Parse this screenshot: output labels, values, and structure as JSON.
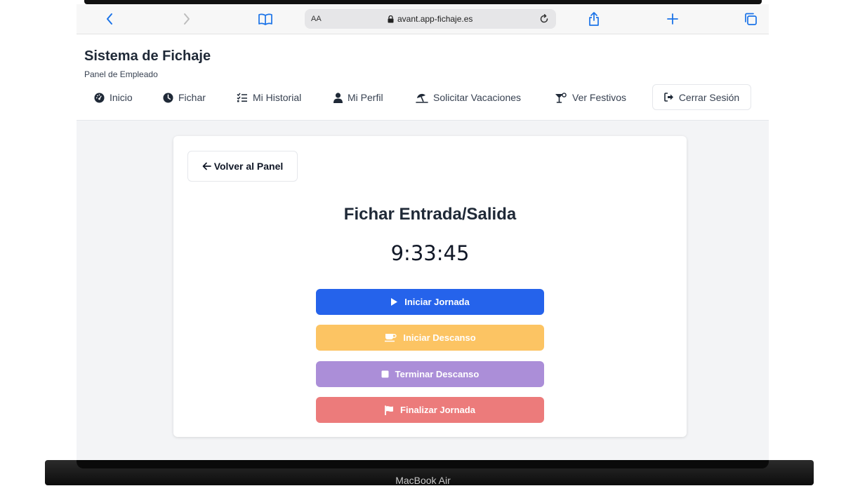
{
  "browser": {
    "address_aa": "AA",
    "url": "avant.app-fichaje.es",
    "icons": [
      "chevron-left-icon",
      "chevron-right-icon",
      "book-icon",
      "lock-icon",
      "reload-icon",
      "share-icon",
      "plus-icon",
      "tabs-icon"
    ]
  },
  "app": {
    "title": "Sistema de Fichaje",
    "subtitle": "Panel de Empleado"
  },
  "nav": {
    "inicio": "Inicio",
    "fichar": "Fichar",
    "historial": "Mi Historial",
    "perfil": "Mi Perfil",
    "vacaciones": "Solicitar Vacaciones",
    "festivos": "Ver Festivos",
    "logout": "Cerrar Sesión"
  },
  "card": {
    "back_label": "Volver al Panel",
    "title": "Fichar Entrada/Salida",
    "clock": "9:33:45",
    "buttons": {
      "start_day": "Iniciar Jornada",
      "start_break": "Iniciar Descanso",
      "end_break": "Terminar Descanso",
      "end_day": "Finalizar Jornada"
    }
  },
  "device": {
    "label": "MacBook Air"
  },
  "colors": {
    "primary": "#2563eb",
    "break_start": "#fcc463",
    "break_end": "#ab8ed8",
    "end_day": "#ec7b7b"
  }
}
